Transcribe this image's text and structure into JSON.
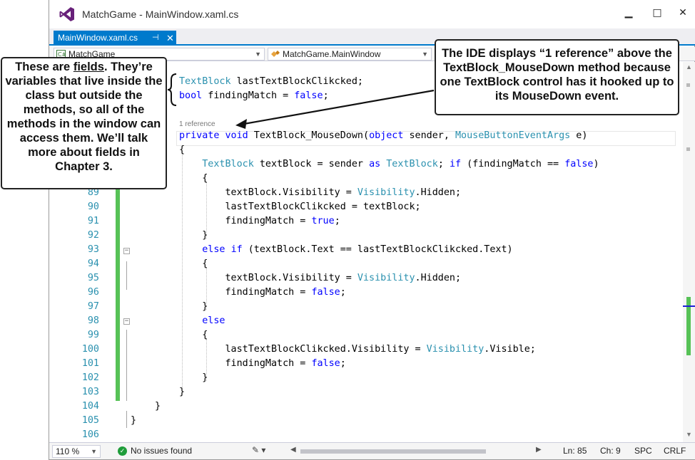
{
  "window": {
    "title": "MatchGame - MainWindow.xaml.cs",
    "minimize_glyph": "▁",
    "maximize_glyph": "□",
    "close_glyph": "✕"
  },
  "tab": {
    "label": "MainWindow.xaml.cs",
    "pin_glyph": "⊣",
    "close_glyph": "✕"
  },
  "navbar": {
    "project": "MatchGame",
    "type": "MatchGame.MainWindow"
  },
  "editor": {
    "codelens": "1 reference",
    "lines": [
      {
        "num": "",
        "parts": [
          {
            "t": "TextBlock",
            "c": "ty"
          },
          {
            "t": " lastTextBlockClikcked;",
            "c": ""
          }
        ]
      },
      {
        "num": "",
        "parts": [
          {
            "t": "bool",
            "c": "kw"
          },
          {
            "t": " findingMatch = ",
            "c": ""
          },
          {
            "t": "false",
            "c": "kw"
          },
          {
            "t": ";",
            "c": ""
          }
        ]
      },
      {
        "num": "",
        "parts": []
      },
      {
        "num": "",
        "parts": [
          {
            "t": "private",
            "c": "kw"
          },
          {
            "t": " ",
            "c": ""
          },
          {
            "t": "void",
            "c": "kw"
          },
          {
            "t": " TextBlock_MouseDown(",
            "c": ""
          },
          {
            "t": "object",
            "c": "kw"
          },
          {
            "t": " sender, ",
            "c": ""
          },
          {
            "t": "MouseButtonEventArgs",
            "c": "ty"
          },
          {
            "t": " e)",
            "c": ""
          }
        ]
      },
      {
        "num": "",
        "parts": [
          {
            "t": "{",
            "c": ""
          }
        ]
      },
      {
        "num": "",
        "parts": [
          {
            "t": "    ",
            "c": ""
          },
          {
            "t": "TextBlock",
            "c": "ty"
          },
          {
            "t": " textBlock = sender ",
            "c": ""
          },
          {
            "t": "as",
            "c": "kw"
          },
          {
            "t": " ",
            "c": ""
          },
          {
            "t": "TextBlock",
            "c": "ty"
          },
          {
            "t": "; ",
            "c": ""
          },
          {
            "t": "if",
            "c": "kw"
          },
          {
            "t": " (findingMatch == ",
            "c": ""
          },
          {
            "t": "false",
            "c": "kw"
          },
          {
            "t": ")",
            "c": ""
          }
        ]
      },
      {
        "num": "",
        "parts": [
          {
            "t": "    {",
            "c": ""
          }
        ]
      },
      {
        "num": "89",
        "parts": [
          {
            "t": "        textBlock.Visibility = ",
            "c": ""
          },
          {
            "t": "Visibility",
            "c": "ty"
          },
          {
            "t": ".Hidden;",
            "c": ""
          }
        ]
      },
      {
        "num": "90",
        "parts": [
          {
            "t": "        lastTextBlockClikcked = textBlock;",
            "c": ""
          }
        ]
      },
      {
        "num": "91",
        "parts": [
          {
            "t": "        findingMatch = ",
            "c": ""
          },
          {
            "t": "true",
            "c": "kw"
          },
          {
            "t": ";",
            "c": ""
          }
        ]
      },
      {
        "num": "92",
        "parts": [
          {
            "t": "    }",
            "c": ""
          }
        ]
      },
      {
        "num": "93",
        "parts": [
          {
            "t": "    ",
            "c": ""
          },
          {
            "t": "else",
            "c": "kw"
          },
          {
            "t": " ",
            "c": ""
          },
          {
            "t": "if",
            "c": "kw"
          },
          {
            "t": " (textBlock.Text == lastTextBlockClikcked.Text)",
            "c": ""
          }
        ]
      },
      {
        "num": "94",
        "parts": [
          {
            "t": "    {",
            "c": ""
          }
        ]
      },
      {
        "num": "95",
        "parts": [
          {
            "t": "        textBlock.Visibility = ",
            "c": ""
          },
          {
            "t": "Visibility",
            "c": "ty"
          },
          {
            "t": ".Hidden;",
            "c": ""
          }
        ]
      },
      {
        "num": "96",
        "parts": [
          {
            "t": "        findingMatch = ",
            "c": ""
          },
          {
            "t": "false",
            "c": "kw"
          },
          {
            "t": ";",
            "c": ""
          }
        ]
      },
      {
        "num": "97",
        "parts": [
          {
            "t": "    }",
            "c": ""
          }
        ]
      },
      {
        "num": "98",
        "parts": [
          {
            "t": "    ",
            "c": ""
          },
          {
            "t": "else",
            "c": "kw"
          }
        ]
      },
      {
        "num": "99",
        "parts": [
          {
            "t": "    {",
            "c": ""
          }
        ]
      },
      {
        "num": "100",
        "parts": [
          {
            "t": "        lastTextBlockClikcked.Visibility = ",
            "c": ""
          },
          {
            "t": "Visibility",
            "c": "ty"
          },
          {
            "t": ".Visible;",
            "c": ""
          }
        ]
      },
      {
        "num": "101",
        "parts": [
          {
            "t": "        findingMatch = ",
            "c": ""
          },
          {
            "t": "false",
            "c": "kw"
          },
          {
            "t": ";",
            "c": ""
          }
        ]
      },
      {
        "num": "102",
        "parts": [
          {
            "t": "    }",
            "c": ""
          }
        ]
      },
      {
        "num": "103",
        "parts": [
          {
            "t": "}",
            "c": ""
          }
        ]
      },
      {
        "num": "104",
        "parts": []
      },
      {
        "num": "105",
        "parts": []
      },
      {
        "num": "106",
        "parts": []
      }
    ],
    "closing_104": "}",
    "closing_105": "}"
  },
  "statusbar": {
    "zoom": "110 %",
    "issues": "No issues found",
    "line": "Ln: 85",
    "column": "Ch: 9",
    "whitespace": "SPC",
    "line_ending": "CRLF"
  },
  "callouts": {
    "left_pre": "These are ",
    "left_link": "fields",
    "left_post": ". They’re variables that live inside the class but outside the methods, so all of the methods in the window can access them. We’ll talk more about fields in Chapter 3.",
    "right": "The IDE displays “1 reference” above the TextBlock_MouseDown method because one TextBlock control has it hooked up to its MouseDown event."
  },
  "colors": {
    "accent": "#007acc",
    "keyword": "#0000ff",
    "type": "#2b91af",
    "change_bar": "#57c257"
  }
}
